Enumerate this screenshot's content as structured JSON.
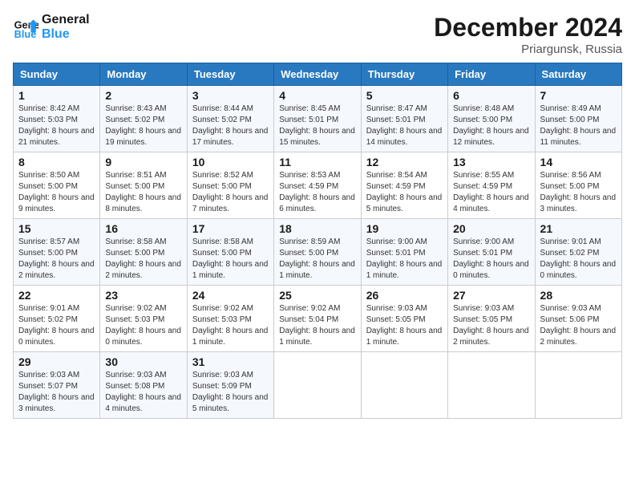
{
  "header": {
    "logo_line1": "General",
    "logo_line2": "Blue",
    "month": "December 2024",
    "location": "Priargunsk, Russia"
  },
  "weekdays": [
    "Sunday",
    "Monday",
    "Tuesday",
    "Wednesday",
    "Thursday",
    "Friday",
    "Saturday"
  ],
  "weeks": [
    [
      {
        "day": "1",
        "sunrise": "Sunrise: 8:42 AM",
        "sunset": "Sunset: 5:03 PM",
        "daylight": "Daylight: 8 hours and 21 minutes."
      },
      {
        "day": "2",
        "sunrise": "Sunrise: 8:43 AM",
        "sunset": "Sunset: 5:02 PM",
        "daylight": "Daylight: 8 hours and 19 minutes."
      },
      {
        "day": "3",
        "sunrise": "Sunrise: 8:44 AM",
        "sunset": "Sunset: 5:02 PM",
        "daylight": "Daylight: 8 hours and 17 minutes."
      },
      {
        "day": "4",
        "sunrise": "Sunrise: 8:45 AM",
        "sunset": "Sunset: 5:01 PM",
        "daylight": "Daylight: 8 hours and 15 minutes."
      },
      {
        "day": "5",
        "sunrise": "Sunrise: 8:47 AM",
        "sunset": "Sunset: 5:01 PM",
        "daylight": "Daylight: 8 hours and 14 minutes."
      },
      {
        "day": "6",
        "sunrise": "Sunrise: 8:48 AM",
        "sunset": "Sunset: 5:00 PM",
        "daylight": "Daylight: 8 hours and 12 minutes."
      },
      {
        "day": "7",
        "sunrise": "Sunrise: 8:49 AM",
        "sunset": "Sunset: 5:00 PM",
        "daylight": "Daylight: 8 hours and 11 minutes."
      }
    ],
    [
      {
        "day": "8",
        "sunrise": "Sunrise: 8:50 AM",
        "sunset": "Sunset: 5:00 PM",
        "daylight": "Daylight: 8 hours and 9 minutes."
      },
      {
        "day": "9",
        "sunrise": "Sunrise: 8:51 AM",
        "sunset": "Sunset: 5:00 PM",
        "daylight": "Daylight: 8 hours and 8 minutes."
      },
      {
        "day": "10",
        "sunrise": "Sunrise: 8:52 AM",
        "sunset": "Sunset: 5:00 PM",
        "daylight": "Daylight: 8 hours and 7 minutes."
      },
      {
        "day": "11",
        "sunrise": "Sunrise: 8:53 AM",
        "sunset": "Sunset: 4:59 PM",
        "daylight": "Daylight: 8 hours and 6 minutes."
      },
      {
        "day": "12",
        "sunrise": "Sunrise: 8:54 AM",
        "sunset": "Sunset: 4:59 PM",
        "daylight": "Daylight: 8 hours and 5 minutes."
      },
      {
        "day": "13",
        "sunrise": "Sunrise: 8:55 AM",
        "sunset": "Sunset: 4:59 PM",
        "daylight": "Daylight: 8 hours and 4 minutes."
      },
      {
        "day": "14",
        "sunrise": "Sunrise: 8:56 AM",
        "sunset": "Sunset: 5:00 PM",
        "daylight": "Daylight: 8 hours and 3 minutes."
      }
    ],
    [
      {
        "day": "15",
        "sunrise": "Sunrise: 8:57 AM",
        "sunset": "Sunset: 5:00 PM",
        "daylight": "Daylight: 8 hours and 2 minutes."
      },
      {
        "day": "16",
        "sunrise": "Sunrise: 8:58 AM",
        "sunset": "Sunset: 5:00 PM",
        "daylight": "Daylight: 8 hours and 2 minutes."
      },
      {
        "day": "17",
        "sunrise": "Sunrise: 8:58 AM",
        "sunset": "Sunset: 5:00 PM",
        "daylight": "Daylight: 8 hours and 1 minute."
      },
      {
        "day": "18",
        "sunrise": "Sunrise: 8:59 AM",
        "sunset": "Sunset: 5:00 PM",
        "daylight": "Daylight: 8 hours and 1 minute."
      },
      {
        "day": "19",
        "sunrise": "Sunrise: 9:00 AM",
        "sunset": "Sunset: 5:01 PM",
        "daylight": "Daylight: 8 hours and 1 minute."
      },
      {
        "day": "20",
        "sunrise": "Sunrise: 9:00 AM",
        "sunset": "Sunset: 5:01 PM",
        "daylight": "Daylight: 8 hours and 0 minutes."
      },
      {
        "day": "21",
        "sunrise": "Sunrise: 9:01 AM",
        "sunset": "Sunset: 5:02 PM",
        "daylight": "Daylight: 8 hours and 0 minutes."
      }
    ],
    [
      {
        "day": "22",
        "sunrise": "Sunrise: 9:01 AM",
        "sunset": "Sunset: 5:02 PM",
        "daylight": "Daylight: 8 hours and 0 minutes."
      },
      {
        "day": "23",
        "sunrise": "Sunrise: 9:02 AM",
        "sunset": "Sunset: 5:03 PM",
        "daylight": "Daylight: 8 hours and 0 minutes."
      },
      {
        "day": "24",
        "sunrise": "Sunrise: 9:02 AM",
        "sunset": "Sunset: 5:03 PM",
        "daylight": "Daylight: 8 hours and 1 minute."
      },
      {
        "day": "25",
        "sunrise": "Sunrise: 9:02 AM",
        "sunset": "Sunset: 5:04 PM",
        "daylight": "Daylight: 8 hours and 1 minute."
      },
      {
        "day": "26",
        "sunrise": "Sunrise: 9:03 AM",
        "sunset": "Sunset: 5:05 PM",
        "daylight": "Daylight: 8 hours and 1 minute."
      },
      {
        "day": "27",
        "sunrise": "Sunrise: 9:03 AM",
        "sunset": "Sunset: 5:05 PM",
        "daylight": "Daylight: 8 hours and 2 minutes."
      },
      {
        "day": "28",
        "sunrise": "Sunrise: 9:03 AM",
        "sunset": "Sunset: 5:06 PM",
        "daylight": "Daylight: 8 hours and 2 minutes."
      }
    ],
    [
      {
        "day": "29",
        "sunrise": "Sunrise: 9:03 AM",
        "sunset": "Sunset: 5:07 PM",
        "daylight": "Daylight: 8 hours and 3 minutes."
      },
      {
        "day": "30",
        "sunrise": "Sunrise: 9:03 AM",
        "sunset": "Sunset: 5:08 PM",
        "daylight": "Daylight: 8 hours and 4 minutes."
      },
      {
        "day": "31",
        "sunrise": "Sunrise: 9:03 AM",
        "sunset": "Sunset: 5:09 PM",
        "daylight": "Daylight: 8 hours and 5 minutes."
      },
      null,
      null,
      null,
      null
    ]
  ]
}
